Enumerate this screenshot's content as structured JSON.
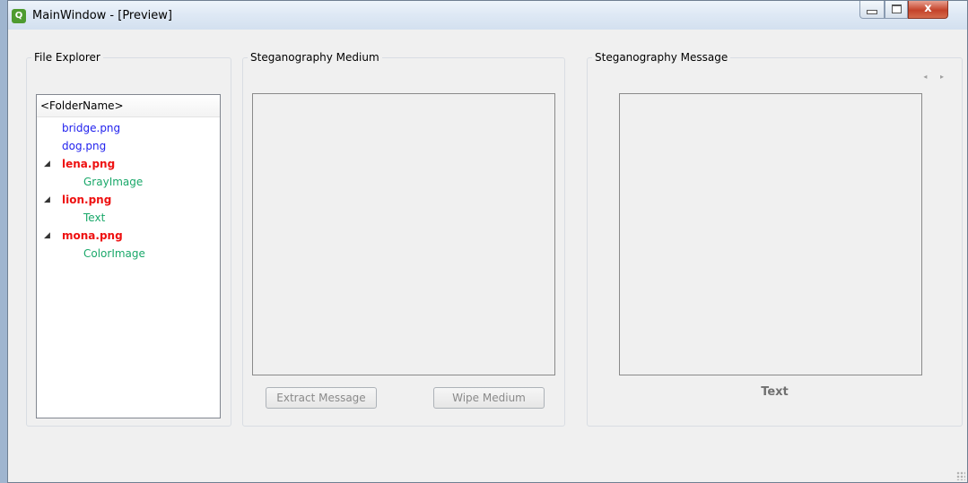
{
  "window": {
    "app_icon_letter": "Q",
    "title": "MainWindow - [Preview]",
    "controls": {
      "minimize": "",
      "maximize": "",
      "close": "x"
    }
  },
  "file_explorer": {
    "title": "File Explorer",
    "header": "<FolderName>",
    "items": [
      {
        "label": "bridge.png",
        "level": 0,
        "expanded": false,
        "color": "#2222ee"
      },
      {
        "label": "dog.png",
        "level": 0,
        "expanded": false,
        "color": "#2222ee"
      },
      {
        "label": "lena.png",
        "level": 0,
        "expanded": true,
        "color": "#ee1111"
      },
      {
        "label": "GrayImage",
        "level": 1,
        "expanded": false,
        "color": "#1aa86a"
      },
      {
        "label": "lion.png",
        "level": 0,
        "expanded": true,
        "color": "#ee1111"
      },
      {
        "label": "Text",
        "level": 1,
        "expanded": false,
        "color": "#1aa86a"
      },
      {
        "label": "mona.png",
        "level": 0,
        "expanded": true,
        "color": "#ee1111"
      },
      {
        "label": "ColorImage",
        "level": 1,
        "expanded": false,
        "color": "#1aa86a"
      }
    ],
    "expanded_arrow_icon": "◢"
  },
  "medium": {
    "title": "Steganography Medium",
    "extract_button": "Extract Message",
    "wipe_button": "Wipe Medium"
  },
  "message": {
    "title": "Steganography Message",
    "nav_icons": "◂ ▸",
    "type_label": "Text"
  }
}
